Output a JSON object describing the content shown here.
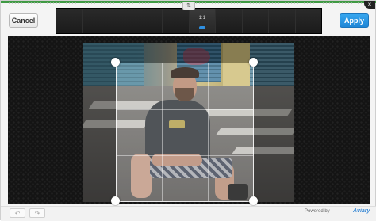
{
  "header": {
    "cancel_label": "Cancel",
    "apply_label": "Apply",
    "close_glyph": "×",
    "crop_tab_glyph": "⇅"
  },
  "toolbar": {
    "aspect_ratio_label": "1:1"
  },
  "footer": {
    "undo_glyph": "↶",
    "redo_glyph": "↷",
    "powered_by": "Powered by",
    "brand": "Aviary"
  },
  "colors": {
    "apply_accent": "#1f86d6",
    "top_bar": "#3f9a43",
    "brand": "#3a8ad6"
  }
}
